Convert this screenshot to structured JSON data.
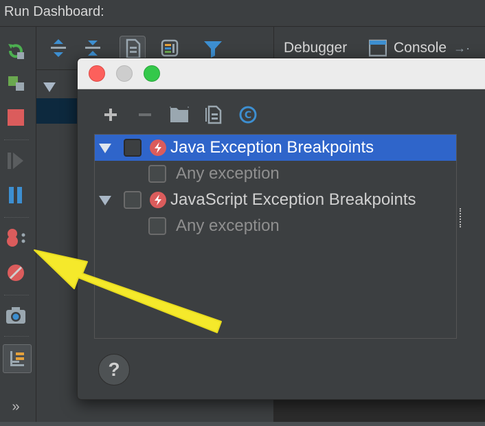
{
  "titlebar": {
    "title": "Run Dashboard:"
  },
  "tabs": {
    "debugger": "Debugger",
    "console": "Console"
  },
  "left_toolbar": {
    "more_label": "»"
  },
  "dialog": {
    "breakpoints": [
      {
        "type": "group",
        "label": "Java Exception Breakpoints",
        "expanded": true,
        "selected": true
      },
      {
        "type": "item",
        "label": "Any exception"
      },
      {
        "type": "group",
        "label": "JavaScript Exception Breakpoints",
        "expanded": true,
        "selected": false
      },
      {
        "type": "item",
        "label": "Any exception"
      }
    ],
    "help_label": "?"
  },
  "colors": {
    "selection": "#2f65ca",
    "close": "#fc605c",
    "minimize": "#c6c6c6",
    "maximize": "#34c84a",
    "annotation_arrow": "#f5e92b"
  }
}
